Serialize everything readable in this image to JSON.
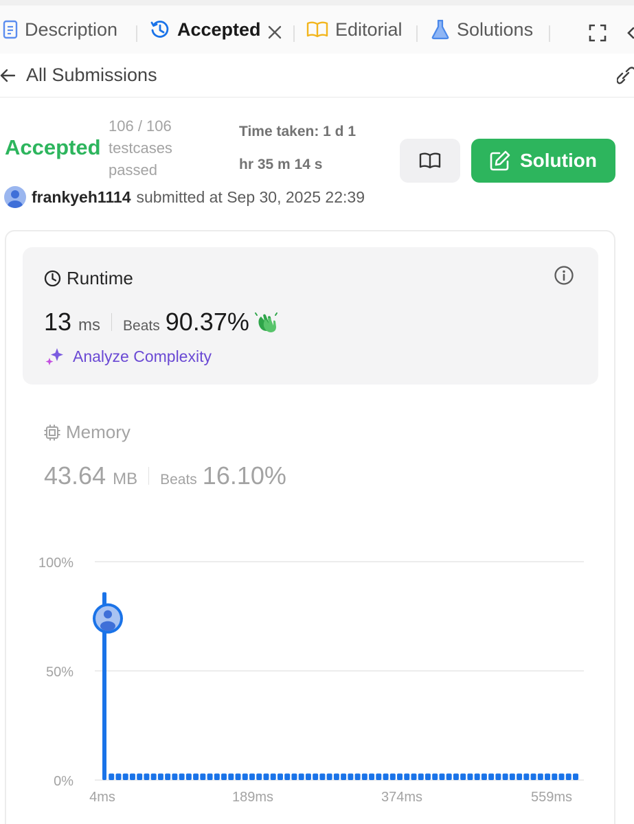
{
  "tabs": [
    {
      "label": "Description",
      "icon": "document-icon"
    },
    {
      "label": "Accepted",
      "icon": "history-icon",
      "active": true
    },
    {
      "label": "Editorial",
      "icon": "book-open-icon"
    },
    {
      "label": "Solutions",
      "icon": "flask-icon"
    }
  ],
  "header": {
    "back_icon": "arrow-left-icon",
    "title": "All Submissions",
    "link_icon": "link-icon"
  },
  "submission": {
    "status": "Accepted",
    "testcases_line1": "106 / 106",
    "testcases_line2": "testcases",
    "testcases_line3": "passed",
    "time_line1": "Time taken: 1 d 1",
    "time_line2": "hr 35 m 14 s",
    "solution_label": "Solution",
    "username": "frankyeh1114",
    "submitted_text": "submitted at Sep 30, 2025 22:39"
  },
  "runtime": {
    "title": "Runtime",
    "value": "13",
    "unit": "ms",
    "beats_label": "Beats",
    "beats_value": "90.37%",
    "analyze_label": "Analyze Complexity"
  },
  "memory": {
    "title": "Memory",
    "value": "43.64",
    "unit": "MB",
    "beats_label": "Beats",
    "beats_value": "16.10%"
  },
  "colors": {
    "accepted": "#2db55d",
    "bar": "#1a73e8",
    "analyze": "#6a49d4"
  },
  "chart_data": {
    "type": "bar",
    "y_ticks": [
      "100%",
      "50%",
      "0%"
    ],
    "ylim": [
      0,
      100
    ],
    "x_ticks": [
      "4ms",
      "189ms",
      "374ms",
      "559ms"
    ],
    "bar_count": 68,
    "highlight_index": 0,
    "highlight_value": 86,
    "base_value": 3,
    "user_marker_value": 74
  }
}
